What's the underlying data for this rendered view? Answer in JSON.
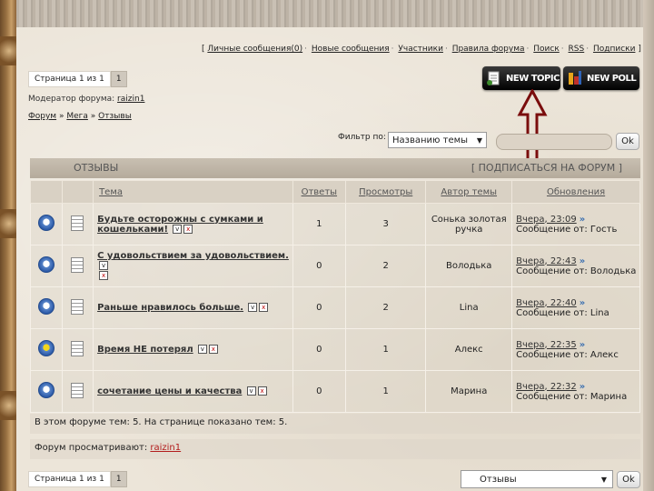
{
  "nav": {
    "open_bracket": "[",
    "close_bracket": "]",
    "items": [
      "Личные сообщения(0)",
      "Новые сообщения",
      "Участники",
      "Правила форума",
      "Поиск",
      "RSS",
      "Подписки"
    ],
    "sep": "·"
  },
  "pager": {
    "label": "Страница 1 из 1",
    "page": "1"
  },
  "moderator": {
    "label": "Модератор форума:",
    "name": "raizin1"
  },
  "breadcrumb": {
    "items": [
      "Форум",
      "Мега",
      "Отзывы"
    ],
    "sep": "»"
  },
  "buttons": {
    "new_topic": "NEW TOPIC",
    "new_poll": "NEW POLL"
  },
  "filter": {
    "label": "Фильтр по:",
    "selected": "Названию темы",
    "ok": "Ok"
  },
  "forum": {
    "title": "ОТЗЫВЫ",
    "subscribe": "[ ПОДПИСАТЬСЯ НА ФОРУМ ]"
  },
  "table": {
    "headers": [
      "Тема",
      "Ответы",
      "Просмотры",
      "Автор темы",
      "Обновления"
    ],
    "rows": [
      {
        "title": "Будьте осторожны с сумками и кошельками!",
        "replies": "1",
        "views": "3",
        "author": "Сонька золотая ручка",
        "updated": "Вчера, 23:09",
        "by": "Сообщение от: Гость",
        "icon": "default"
      },
      {
        "title": "С удовольствием за удовольствием.",
        "replies": "0",
        "views": "2",
        "author": "Володька",
        "updated": "Вчера, 22:43",
        "by": "Сообщение от: Володька",
        "icon": "default"
      },
      {
        "title": "Раньше нравилось больше.",
        "replies": "0",
        "views": "2",
        "author": "Lina",
        "updated": "Вчера, 22:40",
        "by": "Сообщение от: Lina",
        "icon": "default"
      },
      {
        "title": "Время НЕ потерял",
        "replies": "0",
        "views": "1",
        "author": "Алекс",
        "updated": "Вчера, 22:35",
        "by": "Сообщение от: Алекс",
        "icon": "yellow"
      },
      {
        "title": "сочетание цены и качества",
        "replies": "0",
        "views": "1",
        "author": "Марина",
        "updated": "Вчера, 22:32",
        "by": "Сообщение от: Марина",
        "icon": "default"
      }
    ]
  },
  "stats": {
    "text": "В этом форуме тем: 5. На странице показано тем: 5."
  },
  "viewers": {
    "label": "Форум просматривают:",
    "user": "raizin1"
  },
  "bottom": {
    "page_label": "Страница 1 из 1",
    "page": "1",
    "forum_select": "Отзывы",
    "ok": "Ok"
  },
  "colors": {
    "accent_arrow": "#7a0d0d",
    "header_bg": "#c8bfb1",
    "viewer_link": "#b21d1d"
  }
}
